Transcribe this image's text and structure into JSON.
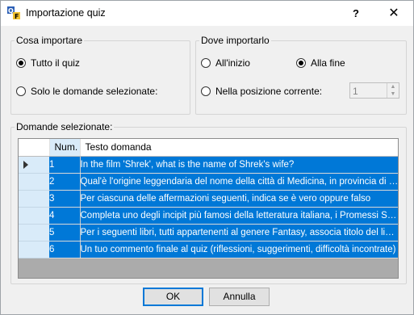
{
  "window": {
    "title": "Importazione quiz",
    "help_label": "?",
    "close_label": "✕"
  },
  "what_group": {
    "legend": "Cosa importare",
    "options": [
      {
        "label": "Tutto il quiz",
        "selected": true
      },
      {
        "label": "Solo le domande selezionate:",
        "selected": false
      }
    ]
  },
  "where_group": {
    "legend": "Dove importarlo",
    "options": [
      {
        "label": "All'inizio",
        "selected": false
      },
      {
        "label": "Alla fine",
        "selected": true
      },
      {
        "label": "Nella posizione corrente:",
        "selected": false
      }
    ],
    "position_value": "1"
  },
  "questions_group": {
    "legend": "Domande selezionate:",
    "columns": {
      "num": "Num.",
      "text": "Testo domanda"
    },
    "rows": [
      {
        "num": "1",
        "text": "In the film 'Shrek', what is the name of Shrek's wife?"
      },
      {
        "num": "2",
        "text": "Qual'è l'origine leggendaria del nome della città di Medicina, in provincia di Bolo..."
      },
      {
        "num": "3",
        "text": "Per ciascuna delle affermazioni seguenti, indica se è vero oppure falso"
      },
      {
        "num": "4",
        "text": " Completa uno degli incipit più famosi della letteratura italiana, i Promessi Sposi d..."
      },
      {
        "num": "5",
        "text": " Per i seguenti libri, tutti appartenenti al genere Fantasy, associa titolo del libro e ..."
      },
      {
        "num": "6",
        "text": "Un tuo commento finale al quiz (riflessioni, suggerimenti, difficoltà incontrate)"
      }
    ]
  },
  "buttons": {
    "ok": "OK",
    "cancel": "Annulla"
  },
  "colors": {
    "selection": "#0078d7",
    "row_header": "#d9ebf9",
    "grid_bg": "#ababab"
  }
}
